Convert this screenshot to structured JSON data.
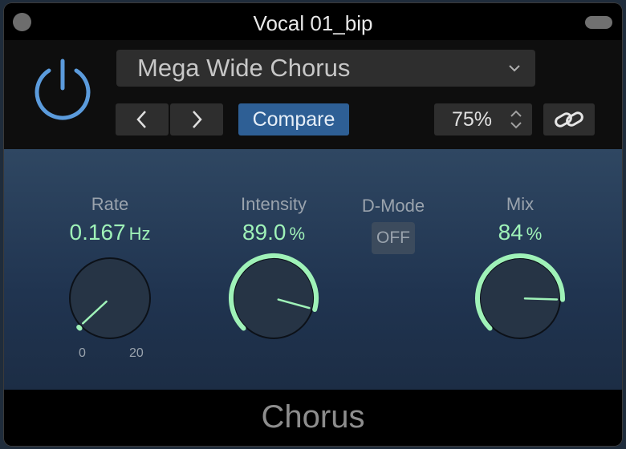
{
  "window": {
    "title": "Vocal 01_bip"
  },
  "header": {
    "preset_name": "Mega Wide Chorus",
    "compare_label": "Compare",
    "zoom_value": "75%"
  },
  "controls": {
    "rate": {
      "label": "Rate",
      "value": "0.167",
      "unit": "Hz",
      "scale_min": "0",
      "scale_max": "20",
      "level": 0.008
    },
    "intensity": {
      "label": "Intensity",
      "value": "89.0",
      "unit": "%",
      "level": 0.89
    },
    "dmode": {
      "label": "D-Mode",
      "state": "OFF"
    },
    "mix": {
      "label": "Mix",
      "value": "84",
      "unit": "%",
      "level": 0.84
    }
  },
  "footer": {
    "plugin_name": "Chorus"
  },
  "colors": {
    "accent": "#9ff2b8",
    "power": "#5b9bdc",
    "compare": "#2e5f95"
  }
}
